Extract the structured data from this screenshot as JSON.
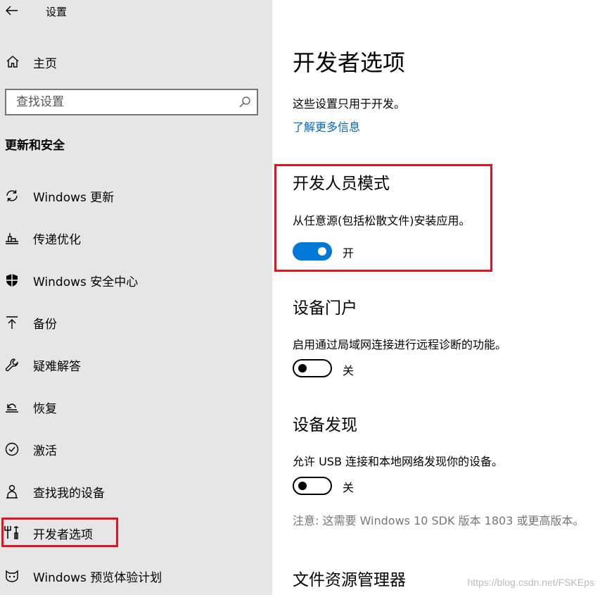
{
  "app": {
    "title": "设置"
  },
  "sidebar": {
    "home_label": "主页",
    "search_placeholder": "查找设置",
    "section_heading": "更新和安全",
    "items": [
      {
        "label": "Windows 更新",
        "icon": "sync-icon"
      },
      {
        "label": "传递优化",
        "icon": "delivery-icon"
      },
      {
        "label": "Windows 安全中心",
        "icon": "shield-icon"
      },
      {
        "label": "备份",
        "icon": "upload-icon"
      },
      {
        "label": "疑难解答",
        "icon": "wrench-icon"
      },
      {
        "label": "恢复",
        "icon": "recovery-icon"
      },
      {
        "label": "激活",
        "icon": "check-circle-icon"
      },
      {
        "label": "查找我的设备",
        "icon": "person-pin-icon"
      },
      {
        "label": "开发者选项",
        "icon": "developer-tools-icon",
        "selected": true
      },
      {
        "label": "Windows 预览体验计划",
        "icon": "insider-cat-icon"
      }
    ]
  },
  "main": {
    "title": "开发者选项",
    "description": "这些设置只用于开发。",
    "learn_more": "了解更多信息",
    "developer_mode": {
      "title": "开发人员模式",
      "description": "从任意源(包括松散文件)安装应用。",
      "state_label": "开",
      "on": true
    },
    "device_portal": {
      "title": "设备门户",
      "description": "启用通过局域网连接进行远程诊断的功能。",
      "state_label": "关",
      "on": false
    },
    "device_discovery": {
      "title": "设备发现",
      "description": "允许 USB 连接和本地网络发现你的设备。",
      "state_label": "关",
      "on": false,
      "note": "注意: 这需要 Windows 10 SDK 版本 1803 或更高版本。"
    },
    "file_explorer": {
      "title": "文件资源管理器"
    }
  },
  "watermark": "https://blog.csdn.net/FSKEps",
  "colors": {
    "accent": "#0078d7",
    "link": "#0067c0",
    "highlight": "#e81123",
    "sidebar_bg": "#e6e6e6"
  }
}
